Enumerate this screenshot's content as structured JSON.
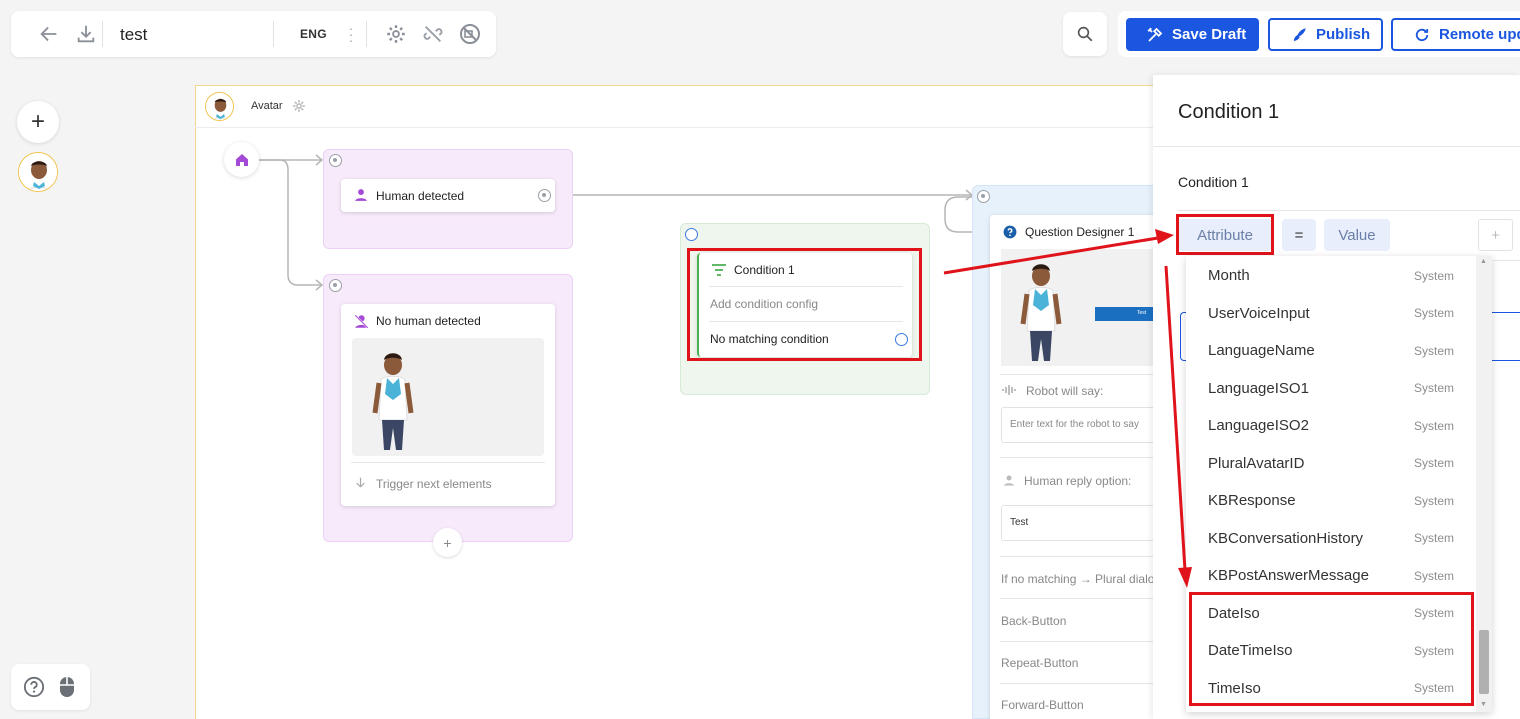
{
  "toolbar": {
    "title": "test",
    "language": "ENG",
    "icons": [
      "back-arrow-icon",
      "download-icon",
      "more-vert-icon",
      "gear-icon",
      "unlink-icon",
      "camera-off-icon"
    ]
  },
  "header_actions": {
    "save_draft": "Save Draft",
    "publish": "Publish",
    "remote_update": "Remote upda"
  },
  "canvas": {
    "avatar_label": "Avatar",
    "nodes": {
      "human_detected": "Human detected",
      "no_human_detected": "No human detected",
      "trigger_next": "Trigger next elements",
      "condition_title": "Condition 1",
      "add_condition_config": "Add condition config",
      "no_matching_condition": "No matching condition",
      "question_designer": "Question Designer 1",
      "robot_will_say": "Robot will say:",
      "robot_text_placeholder": "Enter text for the robot to say",
      "human_reply_option": "Human reply option:",
      "reply_value": "Test",
      "if_no_matching": "If no matching → Plural dialog",
      "back_button": "Back-Button",
      "repeat_button": "Repeat-Button",
      "forward_button": "Forward-Button",
      "preview_button_text": "Test"
    }
  },
  "panel": {
    "title": "Condition 1",
    "subtitle": "Condition 1",
    "attribute_placeholder": "Attribute",
    "operator": "=",
    "value_placeholder": "Value",
    "add_label": "+"
  },
  "dropdown": {
    "items": [
      {
        "name": "Month",
        "tag": "System"
      },
      {
        "name": "UserVoiceInput",
        "tag": "System"
      },
      {
        "name": "LanguageName",
        "tag": "System"
      },
      {
        "name": "LanguageISO1",
        "tag": "System"
      },
      {
        "name": "LanguageISO2",
        "tag": "System"
      },
      {
        "name": "PluralAvatarID",
        "tag": "System"
      },
      {
        "name": "KBResponse",
        "tag": "System"
      },
      {
        "name": "KBConversationHistory",
        "tag": "System"
      },
      {
        "name": "KBPostAnswerMessage",
        "tag": "System"
      },
      {
        "name": "DateIso",
        "tag": "System"
      },
      {
        "name": "DateTimeIso",
        "tag": "System"
      },
      {
        "name": "TimeIso",
        "tag": "System"
      }
    ]
  },
  "colors": {
    "accent": "#1b56e0",
    "highlight": "#e0131a",
    "group_purple": "#f7eafb",
    "group_green": "#eef6ee",
    "group_blue": "#e6f1fb"
  }
}
